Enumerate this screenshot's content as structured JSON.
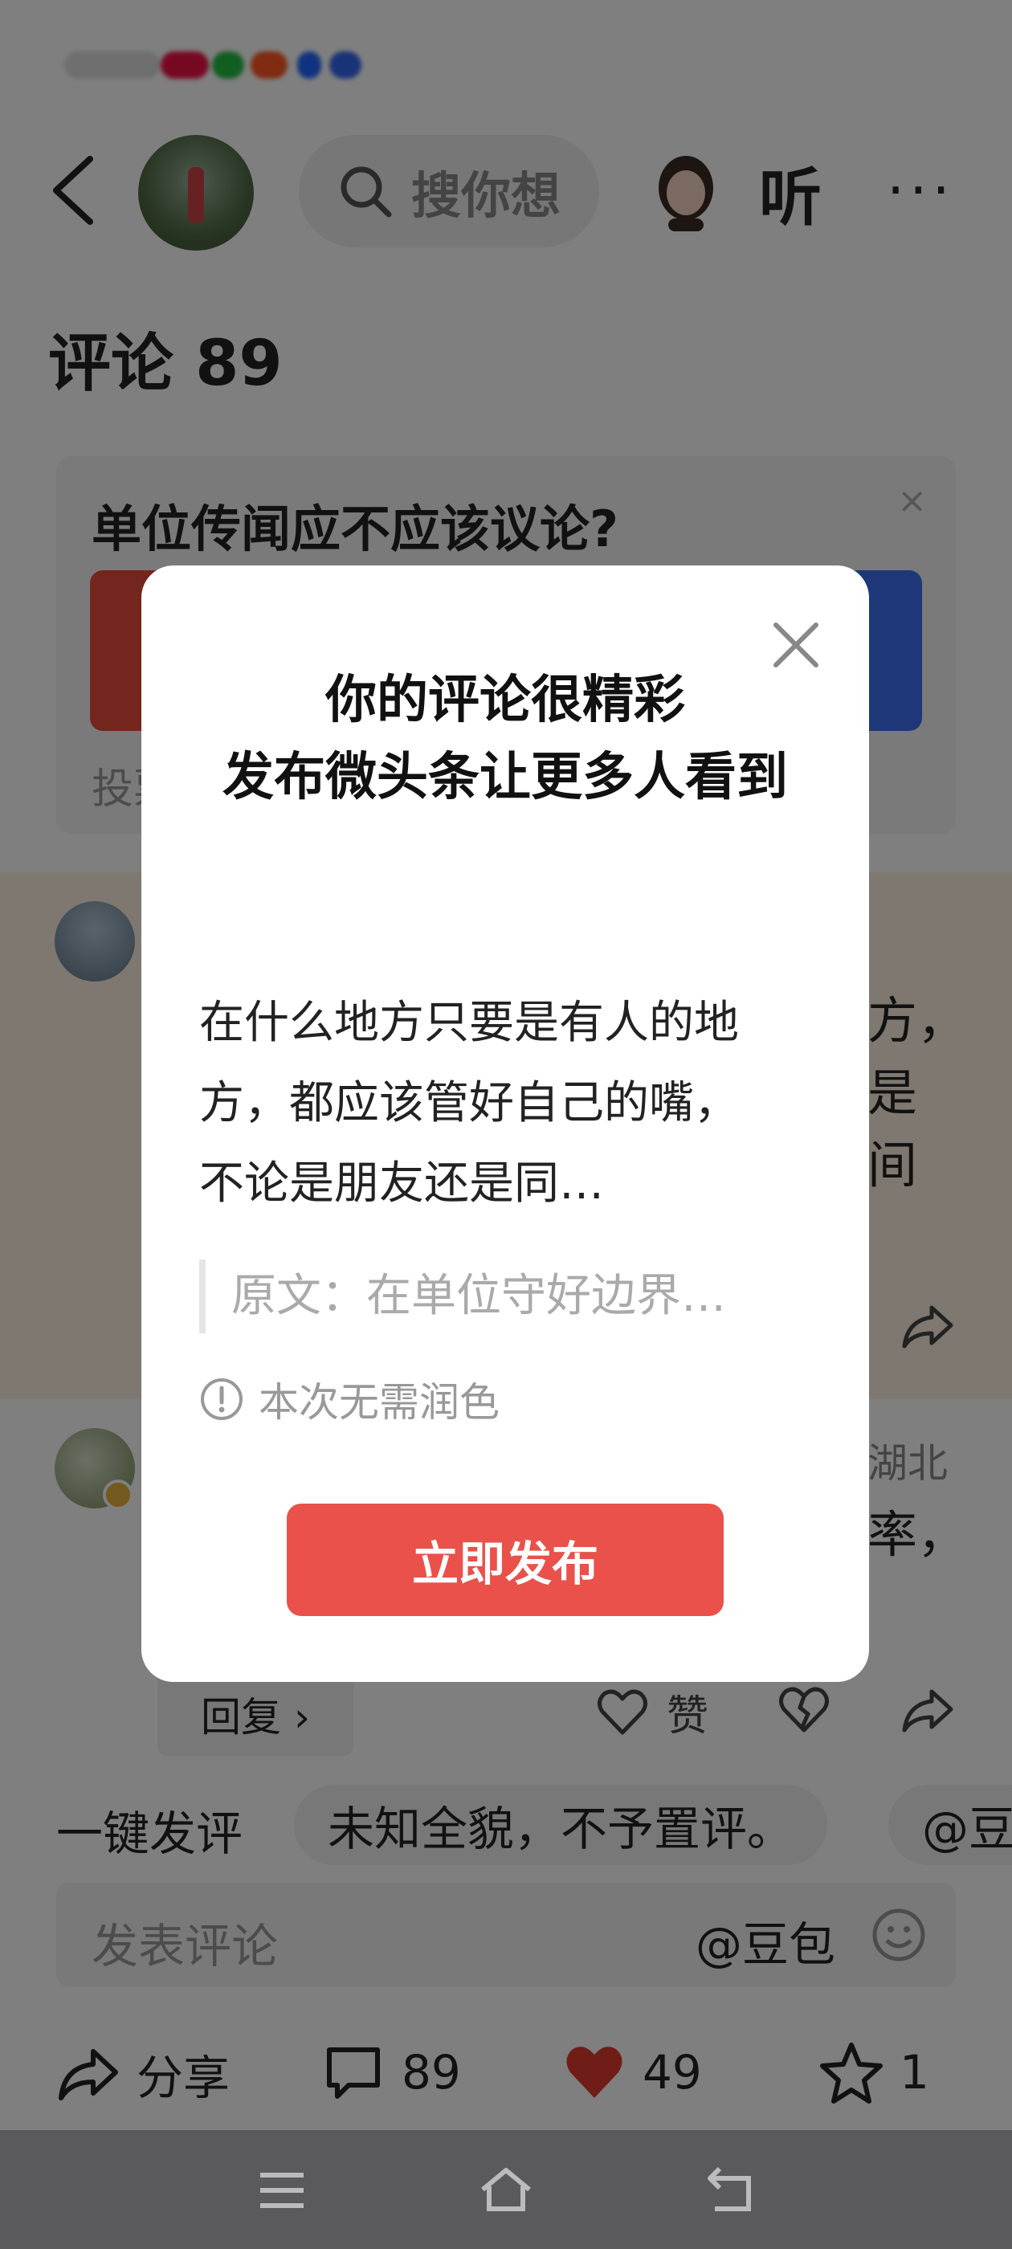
{
  "header": {
    "search_placeholder": "搜你想",
    "listen_label": "听",
    "more_label": "···"
  },
  "comments": {
    "title": "评论 89",
    "poll": {
      "question": "单位传闻应不应该议论?",
      "footer_text": "投票",
      "close_label": "×"
    },
    "comment1": {
      "side_text": "方，\n是\n间"
    },
    "comment2": {
      "location": "湖北",
      "side_text": "率，",
      "reply_label": "回复 ›",
      "like_label": "赞"
    }
  },
  "quick_reply": {
    "label": "一键发评",
    "chips": [
      "未知全貌，不予置评。",
      "@豆"
    ]
  },
  "input_bar": {
    "placeholder": "发表评论",
    "doubao_label": "@豆包"
  },
  "actions": {
    "share_label": "分享",
    "comment_count": "89",
    "like_count": "49",
    "favorite_count": "1"
  },
  "modal": {
    "title_line1": "你的评论很精彩",
    "title_line2": "发布微头条让更多人看到",
    "body": "在什么地方只要是有人的地方，都应该管好自己的嘴，不论是朋友还是同…",
    "quote": "原文：在单位守好边界…",
    "hint": "本次无需润色",
    "publish_label": "立即发布"
  },
  "colors": {
    "publish_button": "#e9514a",
    "poll_left": "#e84b3c",
    "poll_right": "#3b6ff0",
    "like_heart": "#e03a2f"
  }
}
